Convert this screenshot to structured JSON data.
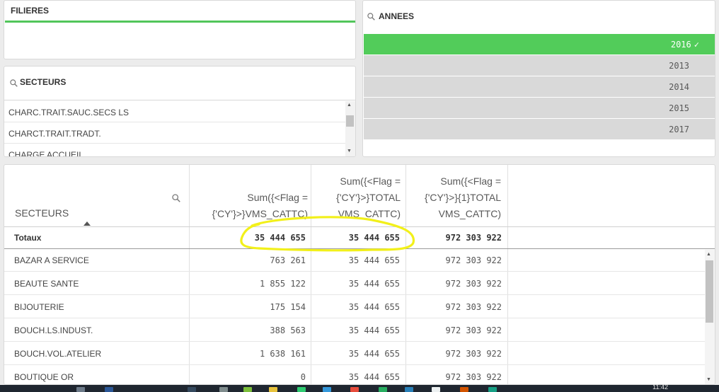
{
  "filieres": {
    "title": "FILIERES"
  },
  "secteurs_filter": {
    "title": "SECTEURS",
    "items": [
      "CHARC.TRAIT.SAUC.SECS LS",
      "CHARCT.TRAIT.TRADT.",
      "CHARGE ACCUEIL"
    ]
  },
  "annees": {
    "title": "ANNEES",
    "items": [
      {
        "label": "2016",
        "selected": true
      },
      {
        "label": "2013",
        "selected": false
      },
      {
        "label": "2014",
        "selected": false
      },
      {
        "label": "2015",
        "selected": false
      },
      {
        "label": "2017",
        "selected": false
      }
    ],
    "check_icon": "✓"
  },
  "table": {
    "dimension_header": "SECTEURS",
    "columns": [
      [
        "Sum({<Flag =",
        "{'CY'}>}VMS_CATTC)"
      ],
      [
        "Sum({<Flag =",
        "{'CY'}>}TOTAL",
        "VMS_CATTC)"
      ],
      [
        "Sum({<Flag =",
        "{'CY'}>}{1}TOTAL",
        "VMS_CATTC)"
      ]
    ],
    "totals": {
      "label": "Totaux",
      "values": [
        "35 444 655",
        "35 444 655",
        "972 303 922"
      ]
    },
    "rows": [
      {
        "label": "BAZAR A SERVICE",
        "values": [
          "763 261",
          "35 444 655",
          "972 303 922"
        ]
      },
      {
        "label": "BEAUTE SANTE",
        "values": [
          "1 855 122",
          "35 444 655",
          "972 303 922"
        ]
      },
      {
        "label": "BIJOUTERIE",
        "values": [
          "175 154",
          "35 444 655",
          "972 303 922"
        ]
      },
      {
        "label": "BOUCH.LS.INDUST.",
        "values": [
          "388 563",
          "35 444 655",
          "972 303 922"
        ]
      },
      {
        "label": "BOUCH.VOL.ATELIER",
        "values": [
          "1 638 161",
          "35 444 655",
          "972 303 922"
        ]
      },
      {
        "label": "BOUTIQUE OR",
        "values": [
          "0",
          "35 444 655",
          "972 303 922"
        ]
      }
    ]
  },
  "annotation": {
    "color": "#f2f01a"
  },
  "taskbar": {
    "clock": "11:42"
  },
  "colors": {
    "accent_green": "#52cc5a",
    "filieres_bar": "#52c65b"
  }
}
